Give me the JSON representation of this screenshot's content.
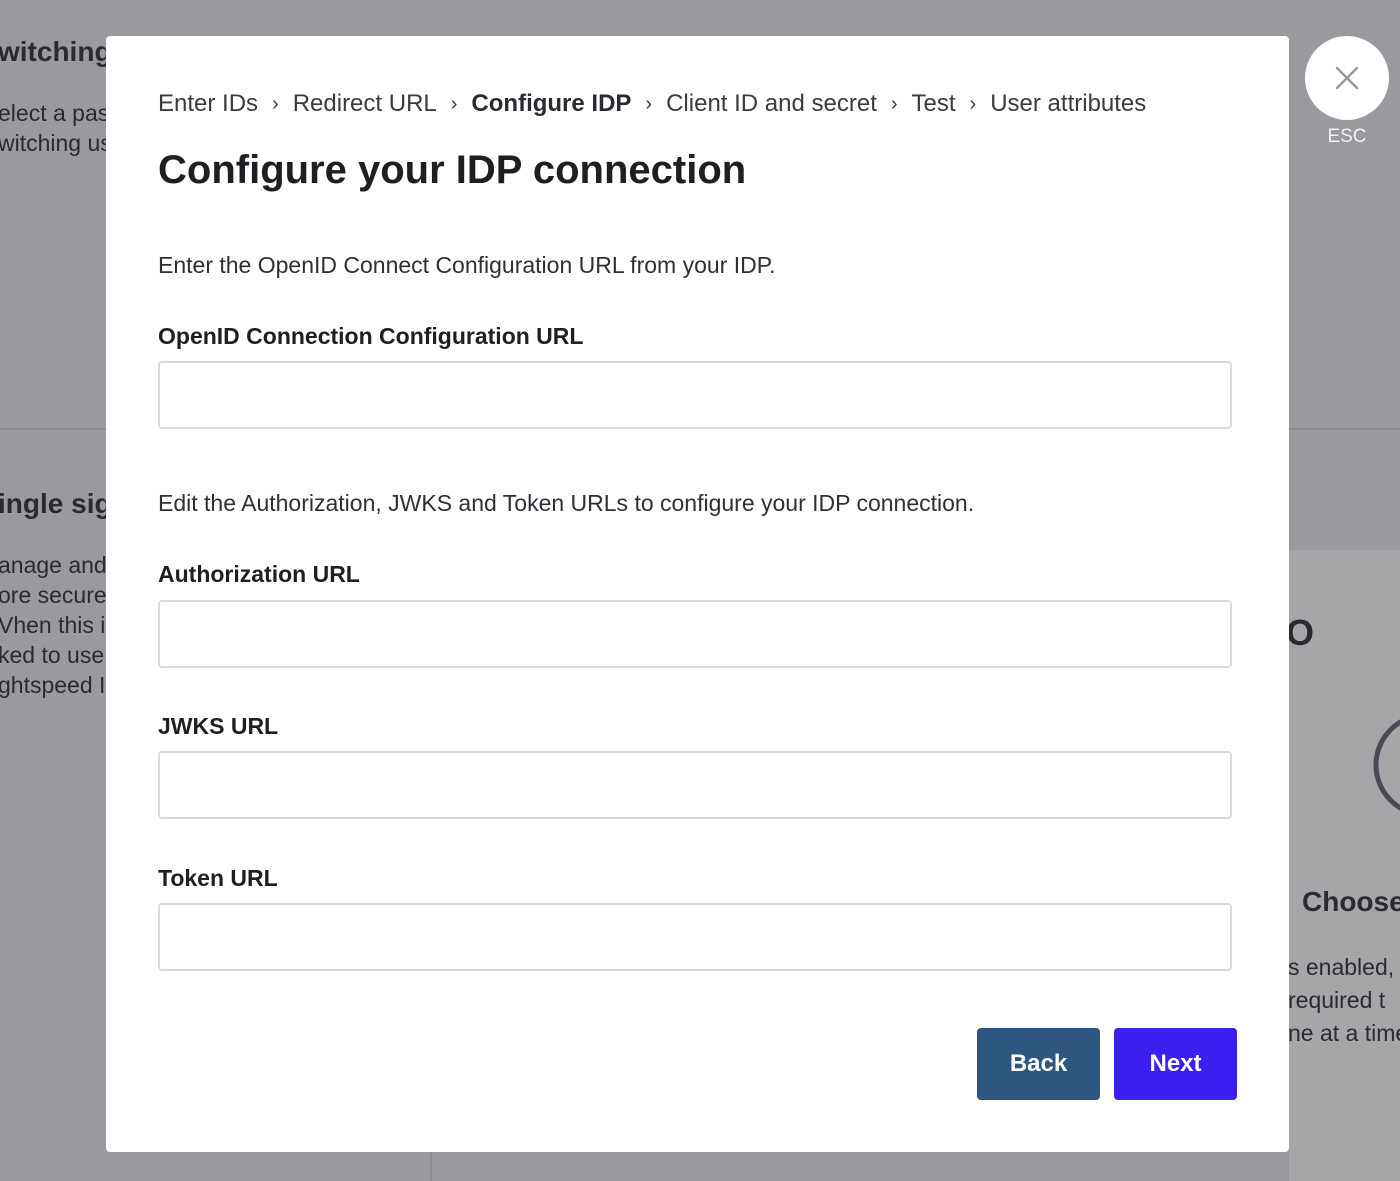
{
  "background": {
    "top_left_heading": "witching",
    "top_left_lines": [
      "elect a pass",
      "witching us"
    ],
    "mid_left_heading": "ingle sign",
    "mid_left_lines": [
      "anage and",
      "ore secure",
      "Vhen this is",
      "ked to use",
      "ghtspeed I"
    ],
    "right_heading_fragment": "O",
    "right_subheading": "Choose",
    "right_lines": [
      "s enabled, a",
      "required t",
      "ne at a time"
    ]
  },
  "modal": {
    "breadcrumb": [
      {
        "label": "Enter IDs",
        "active": false
      },
      {
        "label": "Redirect URL",
        "active": false
      },
      {
        "label": "Configure IDP",
        "active": true
      },
      {
        "label": "Client ID and secret",
        "active": false
      },
      {
        "label": "Test",
        "active": false
      },
      {
        "label": "User attributes",
        "active": false
      }
    ],
    "breadcrumb_separator": "›",
    "title": "Configure your IDP connection",
    "intro_text": "Enter the OpenID Connect Configuration URL from your IDP.",
    "openid_label": "OpenID Connection Configuration URL",
    "openid_value": "",
    "edit_text": "Edit the Authorization, JWKS and Token URLs to configure your IDP connection.",
    "authorization_label": "Authorization URL",
    "authorization_value": "",
    "jwks_label": "JWKS URL",
    "jwks_value": "",
    "token_label": "Token URL",
    "token_value": "",
    "back_label": "Back",
    "next_label": "Next",
    "colors": {
      "back_button": "#2d5680",
      "next_button": "#3b1ff0"
    }
  },
  "close": {
    "icon": "close-icon",
    "label": "ESC"
  }
}
